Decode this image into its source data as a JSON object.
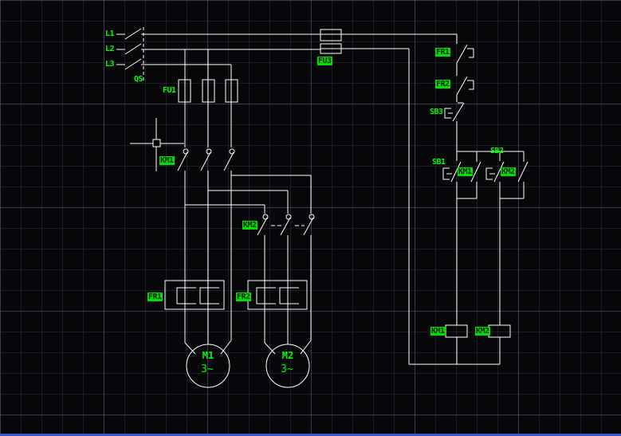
{
  "canvas": {
    "background": "#070709",
    "wire_color": "#ffffff",
    "label_color": "#00ff00",
    "highlight_bg": "#00e000",
    "bottom_bar_color": "#3a5ac8"
  },
  "labels": {
    "phase_l1": "L1",
    "phase_l2": "L2",
    "phase_l3": "L3",
    "qs": "QS",
    "fu1": "FU1",
    "fu3": "FU3",
    "km1_main": "KM1",
    "km2_main": "KM2",
    "fr1_main": "FR1",
    "fr2_main": "FR2",
    "motor1_name": "M1",
    "motor1_type": "3~",
    "motor2_name": "M2",
    "motor2_type": "3~",
    "fr1_ctrl": "FR1",
    "fr2_ctrl": "FR2",
    "sb3": "SB3",
    "sb1": "SB1",
    "sb2": "SB2",
    "km1_aux": "KM1",
    "km2_aux": "KM2",
    "km1_coil": "KM1",
    "km2_coil": "KM2"
  }
}
